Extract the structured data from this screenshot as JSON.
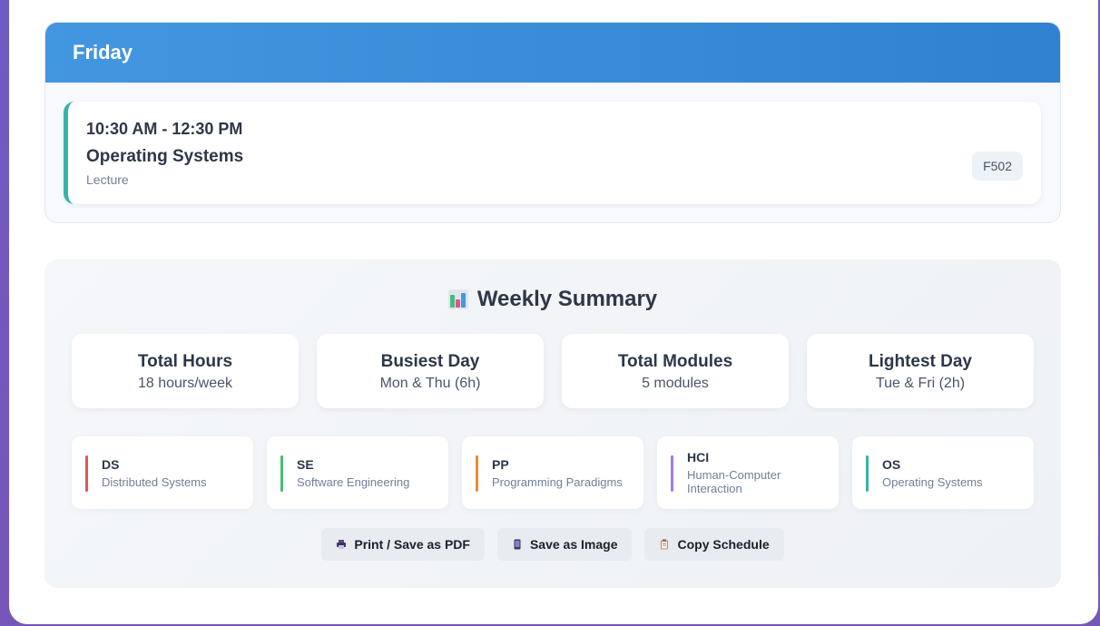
{
  "day": {
    "title": "Friday",
    "class": {
      "time": "10:30 AM - 12:30 PM",
      "name": "Operating Systems",
      "type": "Lecture",
      "room": "F502",
      "accent": "#38b2ac"
    }
  },
  "summary": {
    "title": "Weekly Summary",
    "icon": "bar-chart-icon",
    "stats": [
      {
        "label": "Total Hours",
        "value": "18 hours/week"
      },
      {
        "label": "Busiest Day",
        "value": "Mon & Thu (6h)"
      },
      {
        "label": "Total Modules",
        "value": "5 modules"
      },
      {
        "label": "Lightest Day",
        "value": "Tue & Fri (2h)"
      }
    ],
    "modules": [
      {
        "code": "DS",
        "name": "Distributed Systems",
        "color": "#e05656"
      },
      {
        "code": "SE",
        "name": "Software Engineering",
        "color": "#48bb78"
      },
      {
        "code": "PP",
        "name": "Programming Paradigms",
        "color": "#ed8936"
      },
      {
        "code": "HCI",
        "name": "Human-Computer Interaction",
        "color": "#9f7aea"
      },
      {
        "code": "OS",
        "name": "Operating Systems",
        "color": "#38b2ac"
      }
    ],
    "actions": [
      {
        "label": "Print / Save as PDF",
        "icon": "printer-icon"
      },
      {
        "label": "Save as Image",
        "icon": "phone-icon"
      },
      {
        "label": "Copy Schedule",
        "icon": "clipboard-icon"
      }
    ]
  }
}
